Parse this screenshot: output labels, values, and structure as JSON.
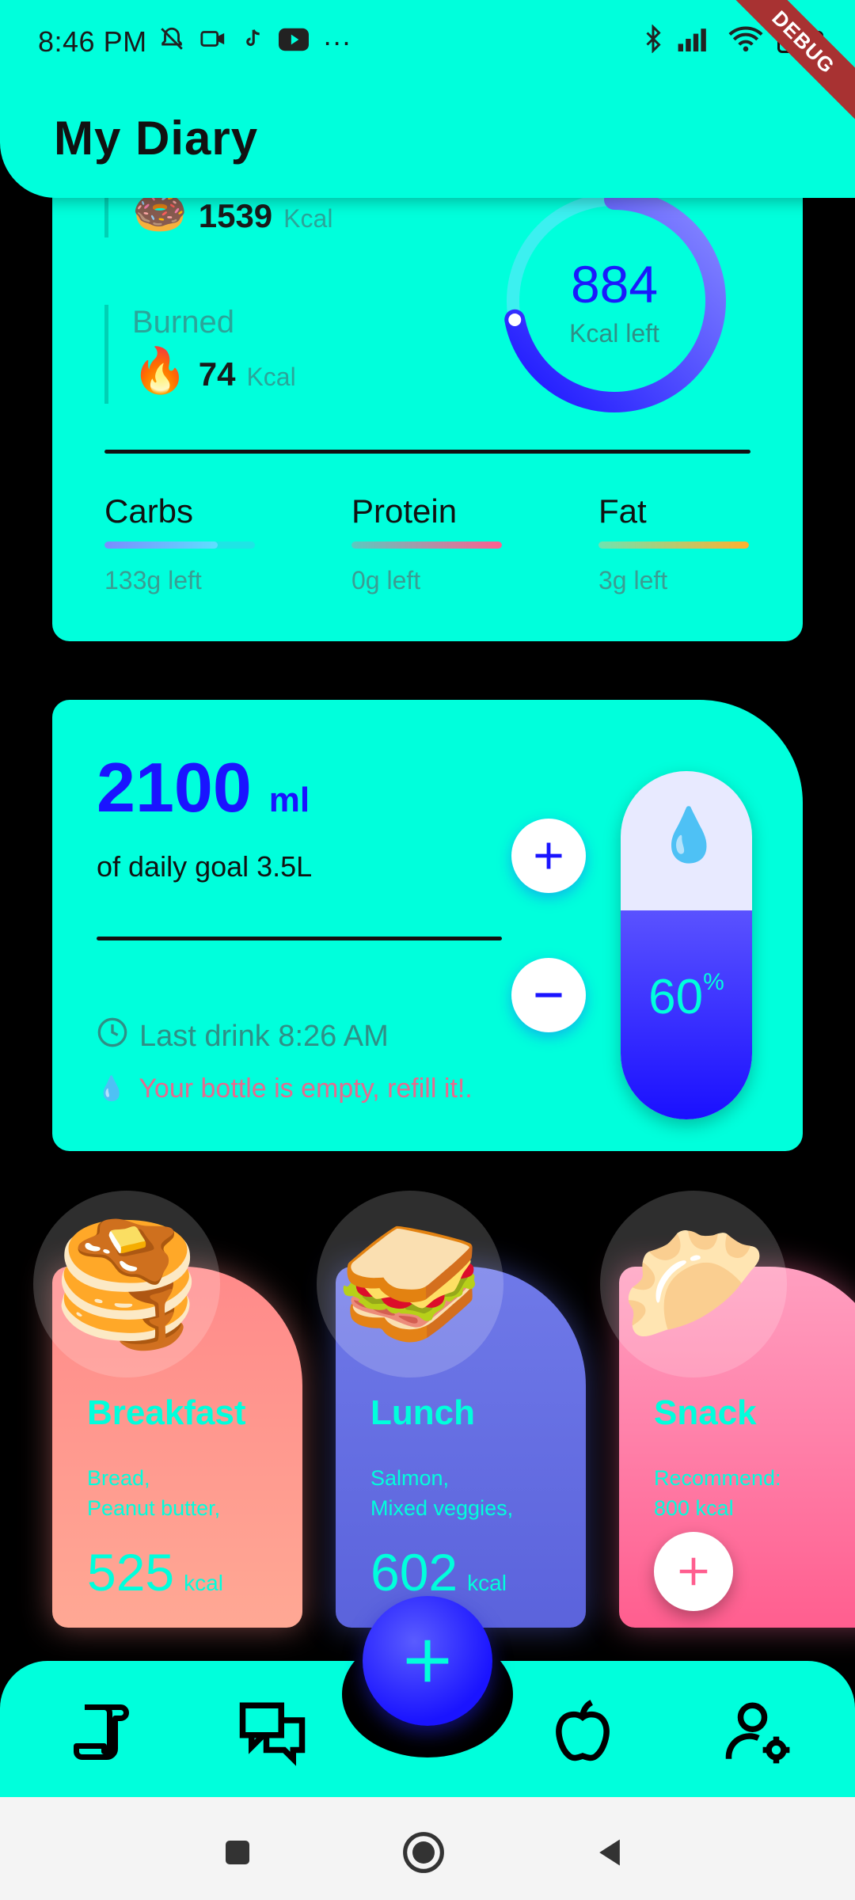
{
  "status_bar": {
    "time": "8:46 PM",
    "more": "···",
    "battery": "100",
    "debug_banner": "DEBUG"
  },
  "header": {
    "title": "My Diary"
  },
  "calories": {
    "eaten_value": "1539",
    "eaten_unit": "Kcal",
    "burned_label": "Burned",
    "burned_value": "74",
    "burned_unit": "Kcal",
    "remaining_value": "884",
    "remaining_label": "Kcal left",
    "ring_progress": 0.72,
    "macros": [
      {
        "name": "Carbs",
        "left": "133g left",
        "progress": 0.75
      },
      {
        "name": "Protein",
        "left": "0g left",
        "progress": 1.0
      },
      {
        "name": "Fat",
        "left": "3g left",
        "progress": 1.0
      }
    ]
  },
  "water": {
    "value": "2100",
    "unit": "ml",
    "goal": "of daily goal 3.5L",
    "last_drink": "Last drink 8:26 AM",
    "refill_msg": "Your bottle is empty, refill it!.",
    "percent": "60",
    "percent_sign": "%",
    "fill_fraction": 0.6
  },
  "meals": [
    {
      "title": "Breakfast",
      "items": "Bread,\nPeanut butter,\nApple",
      "kcal": "525",
      "unit": "kcal"
    },
    {
      "title": "Lunch",
      "items": "Salmon,\nMixed veggies,\nAvocado",
      "kcal": "602",
      "unit": "kcal"
    },
    {
      "title": "Snack",
      "items": "Recommend:\n800 kcal"
    }
  ],
  "colors": {
    "accent": "#00FFDC",
    "primary_blue": "#1A14FF",
    "background": "#000000"
  }
}
